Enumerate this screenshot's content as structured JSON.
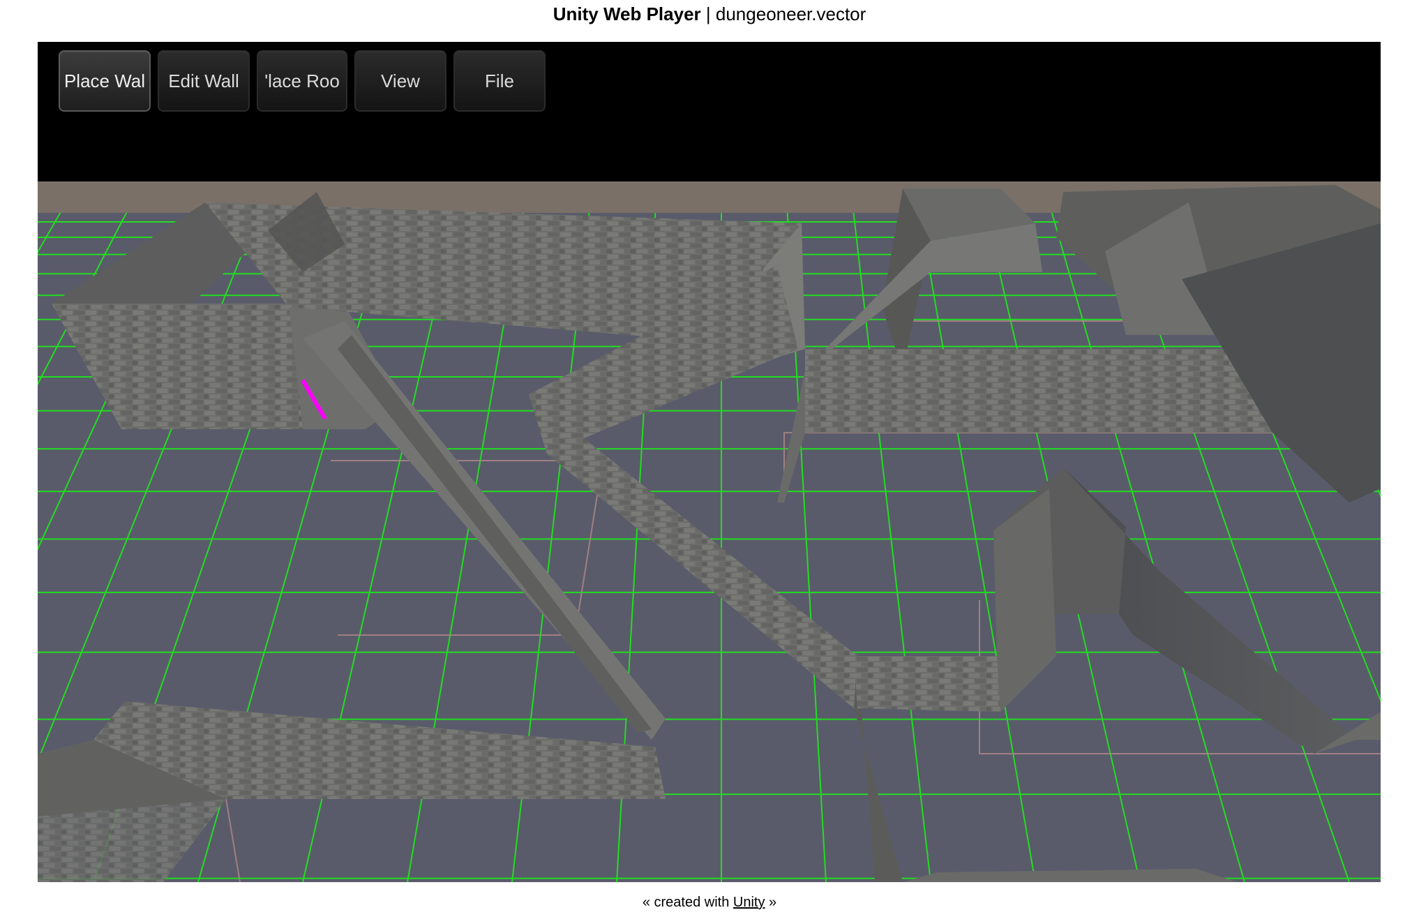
{
  "header": {
    "app_name": "Unity Web Player",
    "separator": "|",
    "project": "dungeoneer.vector"
  },
  "toolbar": {
    "buttons": [
      {
        "label": "Place Wall",
        "visible_label": "Place Wal",
        "active": true
      },
      {
        "label": "Edit Wall",
        "visible_label": "Edit Wall",
        "active": false
      },
      {
        "label": "Place Room",
        "visible_label": "'lace Roo",
        "active": false
      },
      {
        "label": "View",
        "visible_label": "View",
        "active": false
      },
      {
        "label": "File",
        "visible_label": "File",
        "active": false
      }
    ]
  },
  "viewport": {
    "grid_color": "#22dd22",
    "floor_color": "#5a5b6a",
    "sky_color": "#7a7068",
    "wall_color": "#6c6d6b",
    "cursor_color": "#ff00ff"
  },
  "footer": {
    "prefix": "« created with",
    "link": "Unity",
    "suffix": "»"
  }
}
